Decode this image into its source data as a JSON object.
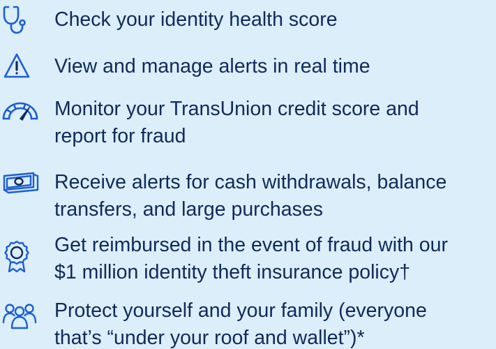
{
  "colors": {
    "background": "#dceefa",
    "text": "#0f2a5c",
    "icon": "#1c5fd4",
    "icon_accent": "#0f2a5c"
  },
  "features": [
    {
      "icon": "stethoscope-icon",
      "lines": [
        "Check your identity health score"
      ]
    },
    {
      "icon": "warning-triangle-icon",
      "lines": [
        "View and manage alerts in real time"
      ]
    },
    {
      "icon": "speedometer-icon",
      "lines": [
        "Monitor your TransUnion credit score and",
        "report for fraud"
      ]
    },
    {
      "icon": "cash-icon",
      "lines": [
        "Receive alerts for cash withdrawals, balance",
        "transfers, and large purchases"
      ]
    },
    {
      "icon": "award-ribbon-icon",
      "lines": [
        "Get reimbursed in the event of fraud with our",
        "$1 million identity theft insurance policy†"
      ]
    },
    {
      "icon": "family-icon",
      "lines": [
        "Protect yourself and your family (everyone",
        "that’s “under your roof and wallet”)*"
      ]
    }
  ]
}
